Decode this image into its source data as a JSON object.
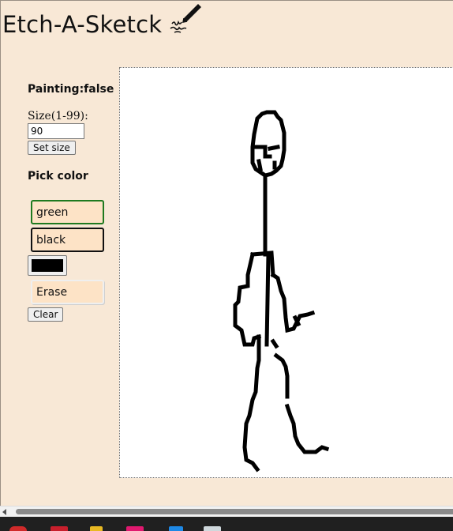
{
  "app": {
    "title": "Etch-A-Sketck"
  },
  "controls": {
    "painting_status": "Painting:false",
    "size_label": "Size(1-99):",
    "size_value": "90",
    "set_size_label": "Set size",
    "pick_color_heading": "Pick color",
    "green_label": "green",
    "black_label": "black",
    "color_value": "#000000",
    "erase_label": "Erase",
    "clear_label": "Clear"
  },
  "colors": {
    "page_background": "#f8e8d6",
    "color_button_fill": "#fde3c6",
    "green_border": "#1f7a1f",
    "paint": "#000000"
  },
  "icons": {
    "title_icon": "pen-writing-icon",
    "scroll_left": "arrow-left-icon"
  }
}
